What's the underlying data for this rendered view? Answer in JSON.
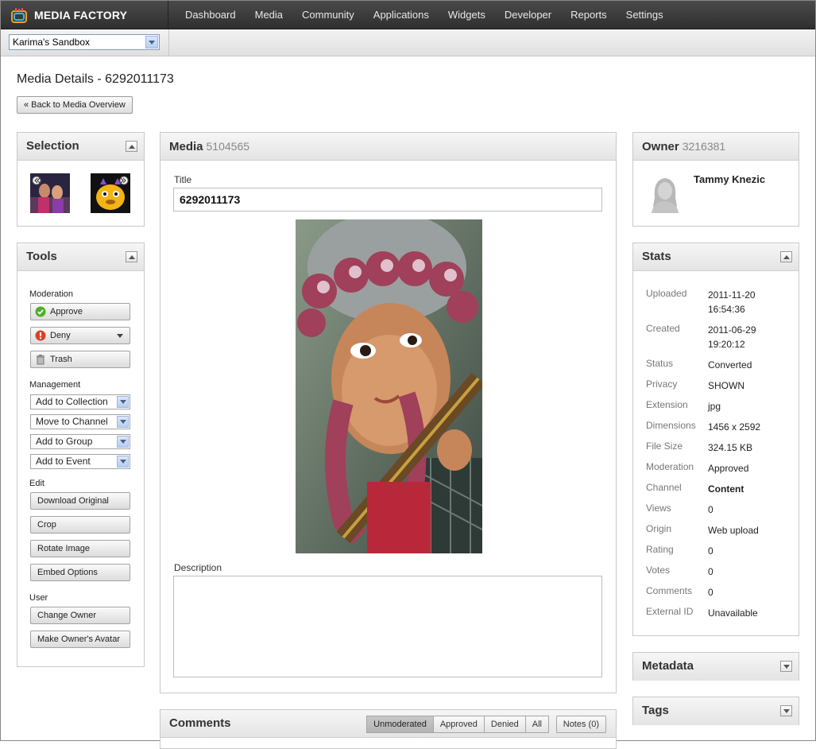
{
  "header": {
    "brand": "MEDIA FACTORY",
    "nav": [
      "Dashboard",
      "Media",
      "Community",
      "Applications",
      "Widgets",
      "Developer",
      "Reports",
      "Settings"
    ]
  },
  "subbar": {
    "site_selector": "Karima's Sandbox"
  },
  "page": {
    "title": "Media Details - 6292011173",
    "back_label": "« Back to Media Overview"
  },
  "selection": {
    "heading": "Selection"
  },
  "tools": {
    "heading": "Tools",
    "moderation_label": "Moderation",
    "approve": "Approve",
    "deny": "Deny",
    "trash": "Trash",
    "management_label": "Management",
    "add_collection": "Add to Collection",
    "move_channel": "Move to Channel",
    "add_group": "Add to Group",
    "add_event": "Add to Event",
    "edit_label": "Edit",
    "download": "Download Original",
    "crop": "Crop",
    "rotate": "Rotate Image",
    "embed": "Embed Options",
    "user_label": "User",
    "change_owner": "Change Owner",
    "make_avatar": "Make Owner's Avatar"
  },
  "media": {
    "heading": "Media",
    "id": "5104565",
    "title_label": "Title",
    "title_value": "6292011173",
    "description_label": "Description",
    "description_value": ""
  },
  "owner": {
    "heading": "Owner",
    "id": "3216381",
    "name": "Tammy Knezic"
  },
  "stats": {
    "heading": "Stats",
    "rows": [
      {
        "key": "Uploaded",
        "value": "2011-11-20 16:54:36"
      },
      {
        "key": "Created",
        "value": "2011-06-29 19:20:12"
      },
      {
        "key": "Status",
        "value": "Converted"
      },
      {
        "key": "Privacy",
        "value": "SHOWN"
      },
      {
        "key": "Extension",
        "value": "jpg"
      },
      {
        "key": "Dimensions",
        "value": "1456 x 2592"
      },
      {
        "key": "File Size",
        "value": "324.15 KB"
      },
      {
        "key": "Moderation",
        "value": "Approved"
      },
      {
        "key": "Channel",
        "value": "Content"
      },
      {
        "key": "Views",
        "value": "0"
      },
      {
        "key": "Origin",
        "value": "Web upload"
      },
      {
        "key": "Rating",
        "value": "0"
      },
      {
        "key": "Votes",
        "value": "0"
      },
      {
        "key": "Comments",
        "value": "0"
      },
      {
        "key": "External ID",
        "value": "Unavailable"
      }
    ]
  },
  "metadata": {
    "heading": "Metadata"
  },
  "tags": {
    "heading": "Tags"
  },
  "comments": {
    "heading": "Comments",
    "tabs": [
      "Unmoderated",
      "Approved",
      "Denied",
      "All"
    ],
    "notes": "Notes (0)"
  },
  "colors": {
    "topbar": "#2f2f2f",
    "approve": "#4caf2a",
    "deny": "#d9412b"
  }
}
